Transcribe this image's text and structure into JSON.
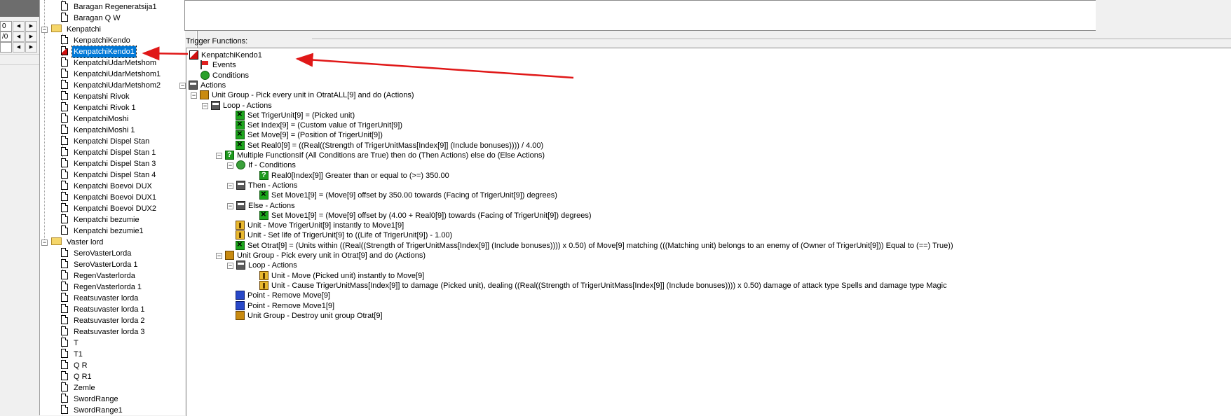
{
  "left_panel": {
    "spinners": [
      {
        "value": "0",
        "left_btn": "◀",
        "right_btn": "▶"
      },
      {
        "value": "/0",
        "left_btn": "◀",
        "right_btn": "▶"
      },
      {
        "value": "",
        "left_btn": "◀",
        "right_btn": "▶"
      }
    ]
  },
  "tree": {
    "items": [
      {
        "label": "Baragan Regeneratsija1",
        "type": "trigger"
      },
      {
        "label": "Baragan Q W",
        "type": "trigger"
      },
      {
        "label": "Kenpatchi",
        "type": "folder"
      },
      {
        "label": "KenpatchiKendo",
        "type": "trigger"
      },
      {
        "label": "KenpatchiKendo1",
        "type": "trigger",
        "selected": true
      },
      {
        "label": "KenpatchiUdarMetshom",
        "type": "trigger"
      },
      {
        "label": "KenpatchiUdarMetshom1",
        "type": "trigger"
      },
      {
        "label": "KenpatchiUdarMetshom2",
        "type": "trigger"
      },
      {
        "label": "Kenpatshi Rivok",
        "type": "trigger"
      },
      {
        "label": "Kenpatchi Rivok 1",
        "type": "trigger"
      },
      {
        "label": "KenpatchiMoshi",
        "type": "trigger"
      },
      {
        "label": "KenpatchiMoshi 1",
        "type": "trigger"
      },
      {
        "label": "Kenpatchi Dispel Stan",
        "type": "trigger"
      },
      {
        "label": "Kenpatchi Dispel Stan 1",
        "type": "trigger"
      },
      {
        "label": "Kenpatchi Dispel Stan 3",
        "type": "trigger"
      },
      {
        "label": "Kenpatchi Dispel Stan 4",
        "type": "trigger"
      },
      {
        "label": "Kenpatchi Boevoi DUX",
        "type": "trigger"
      },
      {
        "label": "Kenpatchi Boevoi DUX1",
        "type": "trigger"
      },
      {
        "label": "Kenpatchi Boevoi DUX2",
        "type": "trigger"
      },
      {
        "label": "Kenpatchi bezumie",
        "type": "trigger"
      },
      {
        "label": "Kenpatchi bezumie1",
        "type": "trigger"
      },
      {
        "label": "Vaster lord",
        "type": "folder"
      },
      {
        "label": "SeroVasterLorda",
        "type": "trigger"
      },
      {
        "label": "SeroVasterLorda 1",
        "type": "trigger"
      },
      {
        "label": "RegenVasterlorda",
        "type": "trigger"
      },
      {
        "label": "RegenVasterlorda 1",
        "type": "trigger"
      },
      {
        "label": "Reatsuvaster lorda",
        "type": "trigger"
      },
      {
        "label": "Reatsuvaster lorda 1",
        "type": "trigger"
      },
      {
        "label": "Reatsuvaster lorda 2",
        "type": "trigger"
      },
      {
        "label": "Reatsuvaster lorda 3",
        "type": "trigger"
      },
      {
        "label": "T",
        "type": "trigger"
      },
      {
        "label": "T1",
        "type": "trigger"
      },
      {
        "label": "Q R",
        "type": "trigger"
      },
      {
        "label": "Q R1",
        "type": "trigger"
      },
      {
        "label": "Zemle",
        "type": "trigger"
      },
      {
        "label": "SwordRange",
        "type": "trigger"
      },
      {
        "label": "SwordRange1",
        "type": "trigger"
      }
    ]
  },
  "trigger_functions": {
    "section_label": "Trigger Functions:",
    "rows": [
      {
        "text": "KenpatchiKendo1",
        "icon": "trigger-icon"
      },
      {
        "text": "Events",
        "icon": "events-flag-icon"
      },
      {
        "text": "Conditions",
        "icon": "conditions-icon"
      },
      {
        "text": "Actions",
        "icon": "actions-icon"
      },
      {
        "text": "Unit Group - Pick every unit in OtratALL[9] and do (Actions)",
        "icon": "unit-group-icon"
      },
      {
        "text": "Loop - Actions",
        "icon": "actions-icon"
      },
      {
        "text": "Set TrigerUnit[9] = (Picked unit)",
        "icon": "set-variable-icon"
      },
      {
        "text": "Set Index[9] = (Custom value of TrigerUnit[9])",
        "icon": "set-variable-icon"
      },
      {
        "text": "Set Move[9] = (Position of TrigerUnit[9])",
        "icon": "set-variable-icon"
      },
      {
        "text": "Set Real0[9] = ((Real((Strength of TrigerUnitMass[Index[9]] (Include bonuses)))) / 4.00)",
        "icon": "set-variable-icon"
      },
      {
        "text": "Multiple FunctionsIf (All Conditions are True) then do (Then Actions) else do (Else Actions)",
        "icon": "multiple-functions-icon"
      },
      {
        "text": "If - Conditions",
        "icon": "if-conditions-icon"
      },
      {
        "text": "Real0[Index[9]] Greater than or equal to (>=) 350.00",
        "icon": "condition-compare-icon"
      },
      {
        "text": "Then - Actions",
        "icon": "actions-icon"
      },
      {
        "text": "Set Move1[9] = (Move[9] offset by 350.00 towards (Facing of TrigerUnit[9]) degrees)",
        "icon": "set-variable-icon"
      },
      {
        "text": "Else - Actions",
        "icon": "actions-icon"
      },
      {
        "text": "Set Move1[9] = (Move[9] offset by (4.00 + Real0[9]) towards (Facing of TrigerUnit[9]) degrees)",
        "icon": "set-variable-icon"
      },
      {
        "text": "Unit - Move TrigerUnit[9] instantly to Move1[9]",
        "icon": "unit-icon"
      },
      {
        "text": "Unit - Set life of TrigerUnit[9] to ((Life of TrigerUnit[9]) - 1.00)",
        "icon": "unit-icon"
      },
      {
        "text": "Set Otrat[9] = (Units within ((Real((Strength of TrigerUnitMass[Index[9]] (Include bonuses)))) x 0.50) of Move[9] matching (((Matching unit) belongs to an enemy of (Owner of TrigerUnit[9])) Equal to (==) True))",
        "icon": "set-variable-icon"
      },
      {
        "text": "Unit Group - Pick every unit in Otrat[9] and do (Actions)",
        "icon": "unit-group-icon"
      },
      {
        "text": "Loop - Actions",
        "icon": "actions-icon"
      },
      {
        "text": "Unit - Move (Picked unit) instantly to Move[9]",
        "icon": "unit-icon"
      },
      {
        "text": "Unit - Cause TrigerUnitMass[Index[9]] to damage (Picked unit), dealing ((Real((Strength of TrigerUnitMass[Index[9]] (Include bonuses)))) x 0.50) damage of attack type Spells and damage type Magic",
        "icon": "unit-icon"
      },
      {
        "text": "Point - Remove Move[9]",
        "icon": "point-icon"
      },
      {
        "text": "Point - Remove Move1[9]",
        "icon": "point-icon"
      },
      {
        "text": "Unit Group - Destroy unit group Otrat[9]",
        "icon": "unit-group-icon"
      }
    ]
  },
  "colors": {
    "selection": "#0078d7",
    "arrow": "#e01818"
  }
}
